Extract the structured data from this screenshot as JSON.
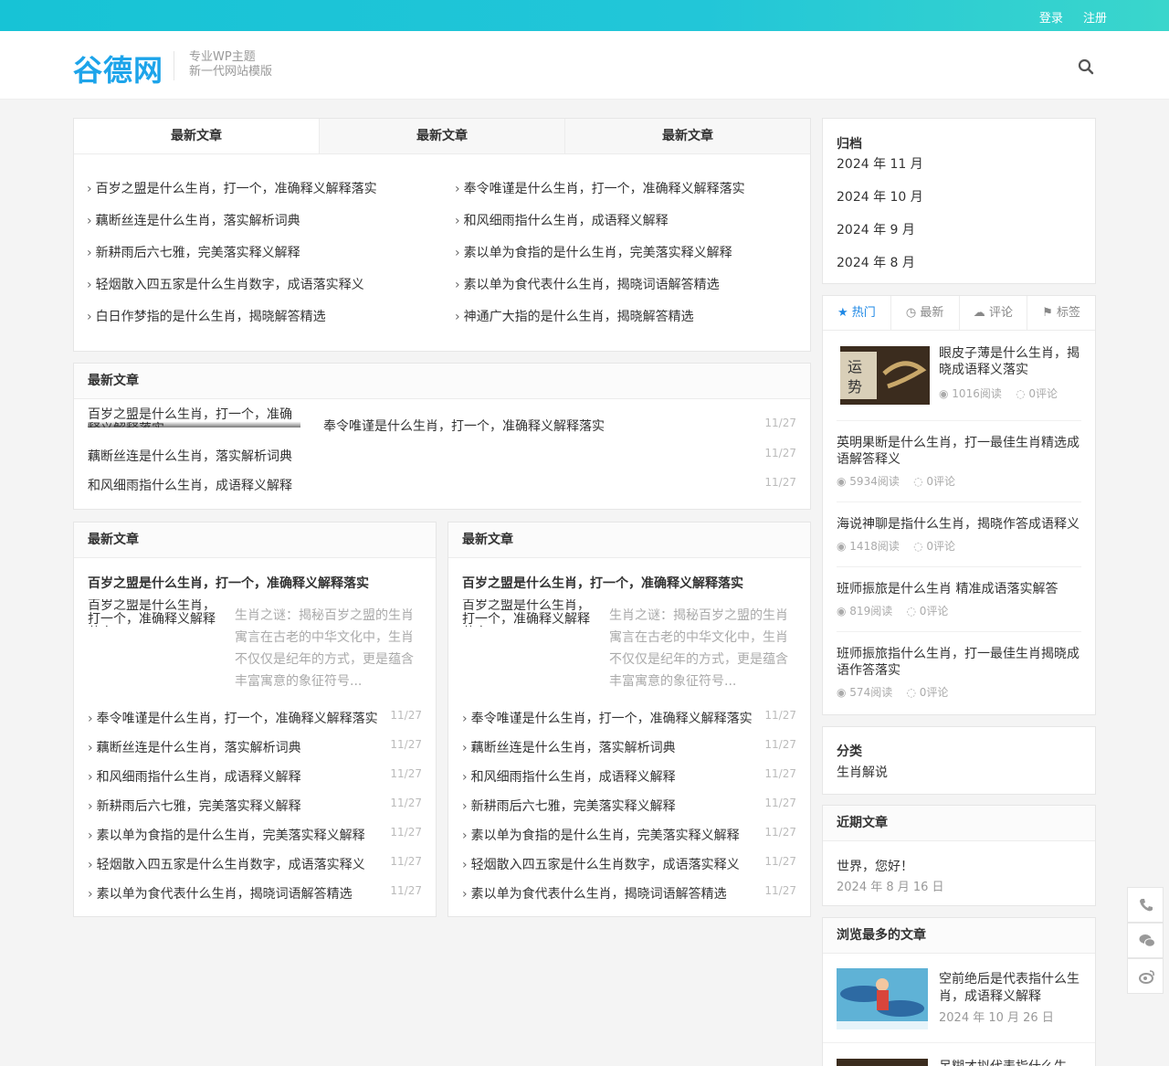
{
  "topbar": {
    "login": "登录",
    "register": "注册"
  },
  "header": {
    "logo": "谷德网",
    "tagline1": "专业WP主题",
    "tagline2": "新一代网站模版"
  },
  "icons": {
    "search": "search-icon",
    "phone": "phone-icon",
    "wechat": "wechat-icon",
    "weibo": "weibo-icon"
  },
  "tabs": [
    "最新文章",
    "最新文章",
    "最新文章"
  ],
  "tabList": {
    "left": [
      "百岁之盟是什么生肖，打一个，准确释义解释落实",
      "藕断丝连是什么生肖，落实解析词典",
      "新耕雨后六七雅，完美落实释义解释",
      "轻烟散入四五家是什么生肖数字，成语落实释义",
      "白日作梦指的是什么生肖，揭晓解答精选"
    ],
    "right": [
      "奉令唯谨是什么生肖，打一个，准确释义解释落实",
      "和风细雨指什么生肖，成语释义解释",
      "素以单为食指的是什么生肖，完美落实释义解释",
      "素以单为食代表什么生肖，揭晓词语解答精选",
      "神通广大指的是什么生肖，揭晓解答精选"
    ]
  },
  "panel2": {
    "title": "最新文章",
    "slideText": "百岁之盟是什么生肖，打一个，准确释义解释落实",
    "rows": [
      {
        "title": "奉令唯谨是什么生肖，打一个，准确释义解释落实",
        "date": "11/27"
      },
      {
        "title": "藕断丝连是什么生肖，落实解析词典",
        "date": "11/27"
      },
      {
        "title": "和风细雨指什么生肖，成语释义解释",
        "date": "11/27"
      }
    ]
  },
  "panel3": {
    "title": "最新文章",
    "featTitle": "百岁之盟是什么生肖，打一个，准确释义解释落实",
    "thumbText": "百岁之盟是什么生肖，打一个，准确释义解释落实",
    "excerpt": "生肖之谜：揭秘百岁之盟的生肖寓言在古老的中华文化中，生肖不仅仅是纪年的方式，更是蕴含丰富寓意的象征符号...",
    "rows": [
      {
        "title": "奉令唯谨是什么生肖，打一个，准确释义解释落实",
        "date": "11/27"
      },
      {
        "title": "藕断丝连是什么生肖，落实解析词典",
        "date": "11/27"
      },
      {
        "title": "和风细雨指什么生肖，成语释义解释",
        "date": "11/27"
      },
      {
        "title": "新耕雨后六七雅，完美落实释义解释",
        "date": "11/27"
      },
      {
        "title": "素以单为食指的是什么生肖，完美落实释义解释",
        "date": "11/27"
      },
      {
        "title": "轻烟散入四五家是什么生肖数字，成语落实释义",
        "date": "11/27"
      },
      {
        "title": "素以单为食代表什么生肖，揭晓词语解答精选",
        "date": "11/27"
      }
    ]
  },
  "archive": {
    "title": "归档",
    "items": [
      "2024 年 11 月",
      "2024 年 10 月",
      "2024 年 9 月",
      "2024 年 8 月"
    ]
  },
  "hotTabs": [
    "热门",
    "最新",
    "评论",
    "标签"
  ],
  "hot": [
    {
      "title": "眼皮子薄是什么生肖，揭晓成语释义落实",
      "views": "1016阅读",
      "comments": "0评论"
    },
    {
      "title": "英明果断是什么生肖，打一最佳生肖精选成语解答释义",
      "views": "5934阅读",
      "comments": "0评论"
    },
    {
      "title": "海说神聊是指什么生肖，揭晓作答成语释义",
      "views": "1418阅读",
      "comments": "0评论"
    },
    {
      "title": "班师振旅是什么生肖 精准成语落实解答",
      "views": "819阅读",
      "comments": "0评论"
    },
    {
      "title": "班师振旅指什么生肖，打一最佳生肖揭晓成语作答落实",
      "views": "574阅读",
      "comments": "0评论"
    }
  ],
  "category": {
    "title": "分类",
    "item": "生肖解说"
  },
  "recent": {
    "title": "近期文章",
    "item": "世界，您好！",
    "date": "2024 年 8 月 16 日"
  },
  "most": {
    "title": "浏览最多的文章",
    "item": "空前绝后是代表指什么生肖，成语释义解释",
    "date": "2024 年 10 月 26 日",
    "next": "呆糊才拟代表指什么生"
  }
}
